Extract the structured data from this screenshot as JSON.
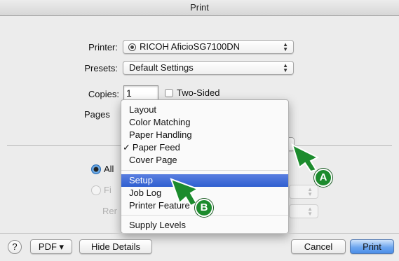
{
  "window": {
    "title": "Print"
  },
  "printer": {
    "label": "Printer:",
    "value": "RICOH AficioSG7100DN"
  },
  "presets": {
    "label": "Presets:",
    "value": "Default Settings"
  },
  "copies": {
    "label": "Copies:",
    "value": "1",
    "two_sided_label": "Two-Sided"
  },
  "pages": {
    "label": "Pages"
  },
  "radios": {
    "all_label": "All",
    "first_label": "Fi"
  },
  "render": {
    "label": "Rer"
  },
  "menu": {
    "items": [
      {
        "label": "Layout",
        "checked": false,
        "highlighted": false
      },
      {
        "label": "Color Matching",
        "checked": false,
        "highlighted": false
      },
      {
        "label": "Paper Handling",
        "checked": false,
        "highlighted": false
      },
      {
        "label": "Paper Feed",
        "checked": true,
        "highlighted": false
      },
      {
        "label": "Cover Page",
        "checked": false,
        "highlighted": false
      },
      {
        "label": "Setup",
        "checked": false,
        "highlighted": true
      },
      {
        "label": "Job Log",
        "checked": false,
        "highlighted": false
      },
      {
        "label": "Printer Feature",
        "checked": false,
        "highlighted": false
      },
      {
        "label": "Supply Levels",
        "checked": false,
        "highlighted": false
      }
    ],
    "check_glyph": "✓"
  },
  "footer": {
    "help_label": "?",
    "pdf_label": "PDF ▾",
    "hide_details_label": "Hide Details",
    "cancel_label": "Cancel",
    "print_label": "Print"
  },
  "callouts": {
    "a_label": "A",
    "b_label": "B",
    "color": "#1c8b2d"
  },
  "icons": {
    "printer_status": "printer-status-icon",
    "updown": "updown-arrows-icon"
  }
}
